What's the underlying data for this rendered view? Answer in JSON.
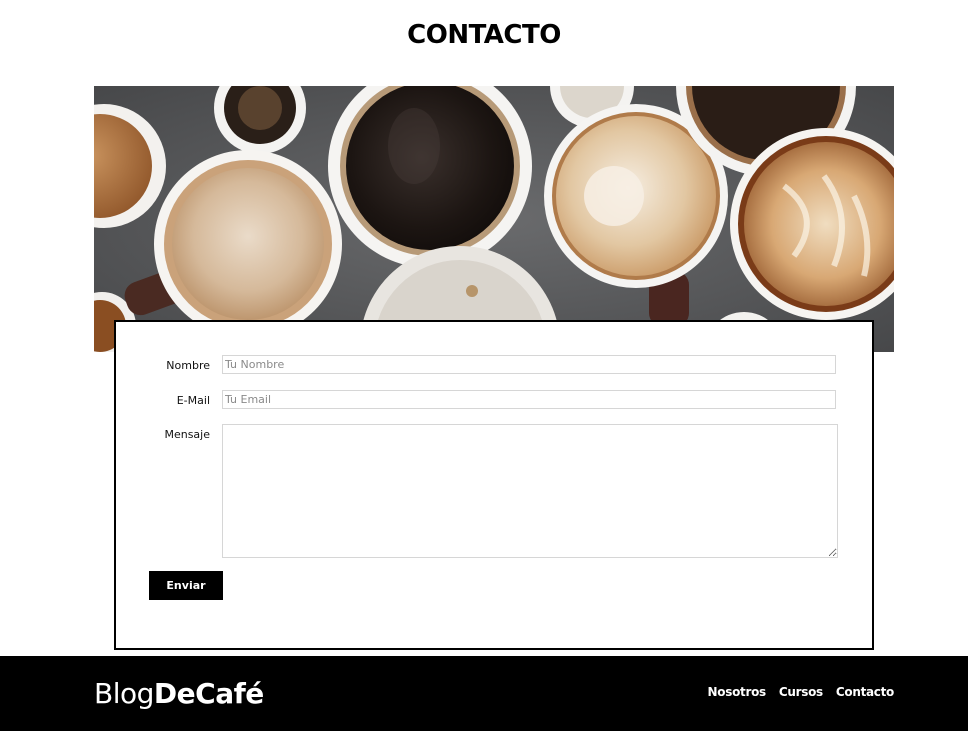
{
  "page": {
    "title": "CONTACTO"
  },
  "hero": {
    "image_alt": "Tazas de café vistas desde arriba"
  },
  "form": {
    "name_label": "Nombre",
    "name_placeholder": "Tu Nombre",
    "email_label": "E-Mail",
    "email_placeholder": "Tu Email",
    "message_label": "Mensaje",
    "submit_label": "Enviar"
  },
  "footer": {
    "logo_light": "Blog",
    "logo_bold": "DeCafé",
    "nav": [
      {
        "label": "Nosotros"
      },
      {
        "label": "Cursos"
      },
      {
        "label": "Contacto"
      }
    ]
  },
  "colors": {
    "background": "#ffffff",
    "footer": "#000000",
    "button": "#000000",
    "input_border": "#d6d6d6"
  }
}
